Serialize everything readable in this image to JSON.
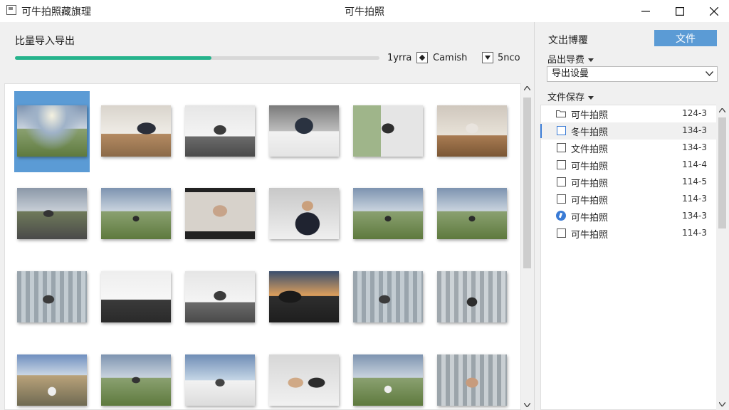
{
  "window": {
    "app_title": "可牛拍照藏旗理",
    "center_title": "可牛拍照"
  },
  "export": {
    "title": "比量导入导出",
    "progress": 0.54,
    "option_1": "1yrra",
    "option_2": "Camish",
    "option_3": "5nco",
    "option_2_checked": true,
    "option_3_checked": true,
    "accent": "#26b38c"
  },
  "gallery": {
    "selected_index": 0,
    "thumbs": [
      "landscape",
      "office-man",
      "office-woman",
      "laptop-desk",
      "office-man-window",
      "office-woman-desk",
      "road-man",
      "field-sitter",
      "monitor-woman",
      "man-suit",
      "field-sitter",
      "field-sitter",
      "greenhouse-man",
      "office-room",
      "office-woman",
      "sunset-monitor",
      "greenhouse-man",
      "greenhouse-sitter",
      "house-lying",
      "field-man",
      "field-laptop",
      "two-people",
      "field-lying",
      "greenhouse-woman"
    ]
  },
  "right": {
    "title": "文出博覆",
    "button_label": "文件",
    "sub1": "品出导费",
    "select_value": "导出设曼",
    "sub2": "文件保存",
    "files": [
      {
        "name": "可牛拍照",
        "size": "124-3",
        "kind": "folder"
      },
      {
        "name": "冬牛拍照",
        "size": "134-3",
        "kind": "check",
        "selected": true
      },
      {
        "name": "文件拍照",
        "size": "134-3",
        "kind": "check"
      },
      {
        "name": "可牛拍照",
        "size": "114-4",
        "kind": "check"
      },
      {
        "name": "可牛拍照",
        "size": "114-5",
        "kind": "check"
      },
      {
        "name": "可牛拍照",
        "size": "114-3",
        "kind": "check"
      },
      {
        "name": "可牛拍照",
        "size": "134-3",
        "kind": "radio"
      },
      {
        "name": "可牛拍照",
        "size": "114-3",
        "kind": "check"
      }
    ]
  },
  "icons": {
    "app": "app-icon",
    "minimize": "minimize-icon",
    "maximize": "maximize-icon",
    "close": "close-icon",
    "dropdown": "chevron-down-icon",
    "folder": "folder-icon"
  }
}
